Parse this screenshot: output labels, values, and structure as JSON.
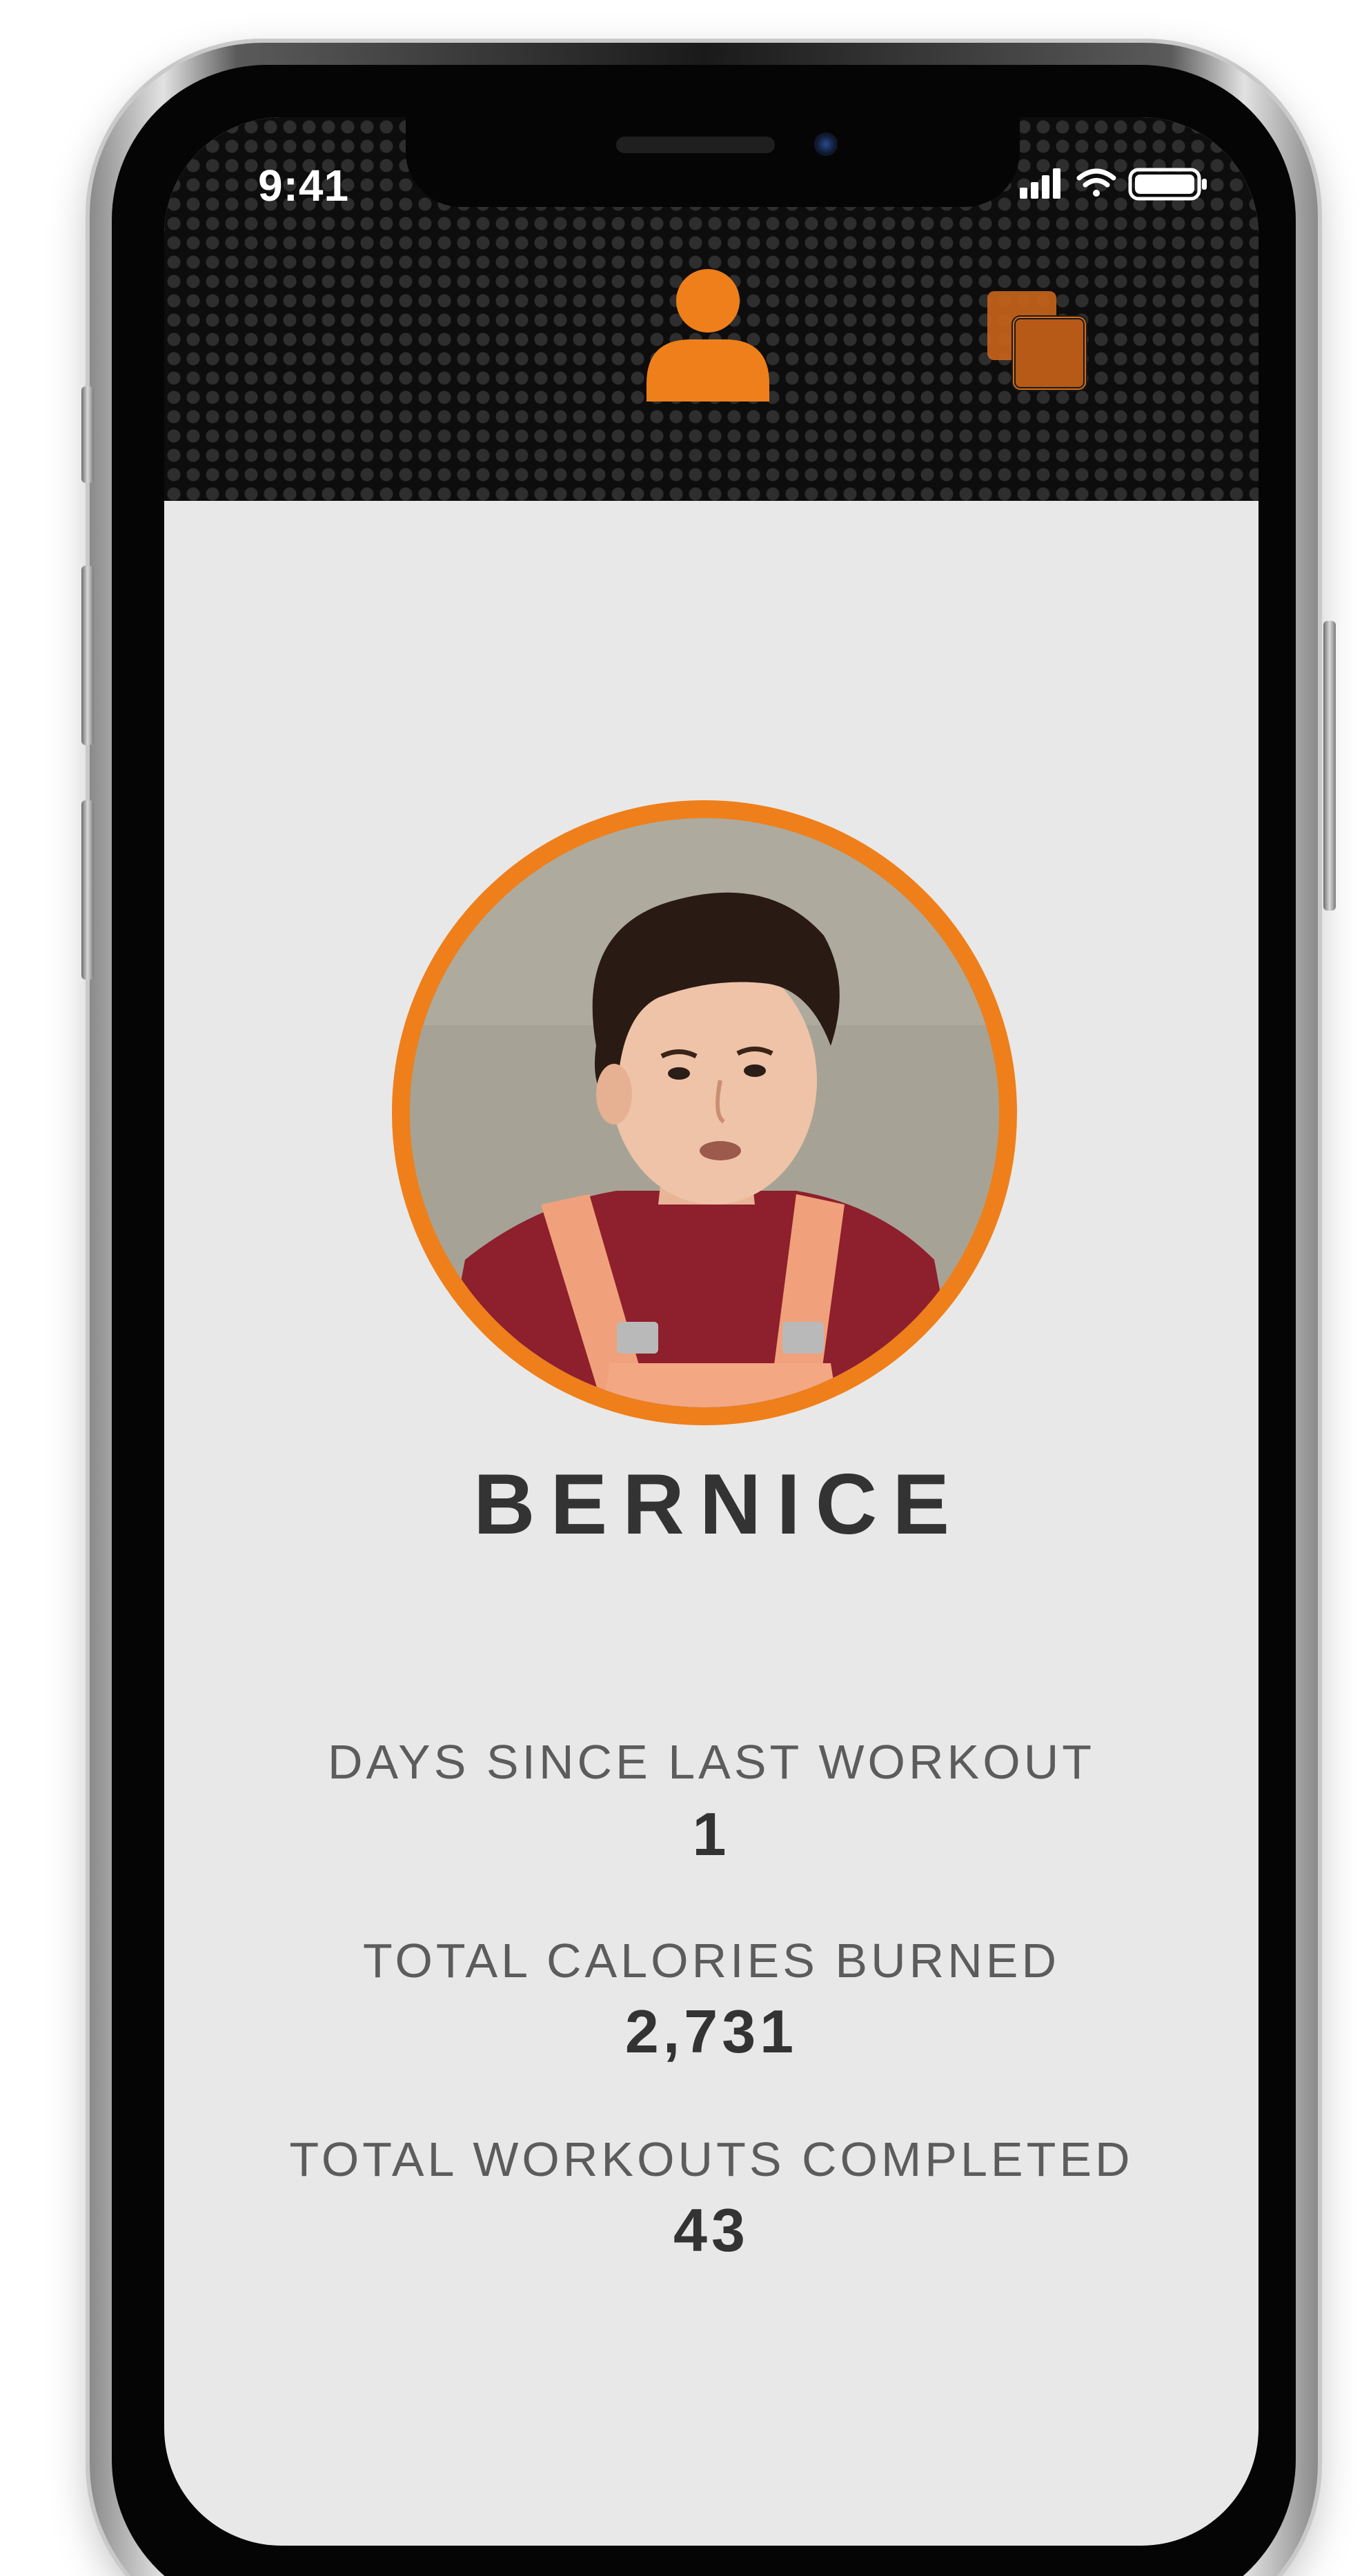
{
  "status_bar": {
    "time": "9:41"
  },
  "header": {
    "profile_icon": "person-icon",
    "cards_icon": "stacked-cards-icon",
    "accent_color": "#EF7F1A"
  },
  "profile": {
    "name": "BERNICE",
    "avatar_description_icon": "user-photo"
  },
  "stats": [
    {
      "label": "DAYS SINCE LAST WORKOUT",
      "value": "1"
    },
    {
      "label": "TOTAL CALORIES BURNED",
      "value": "2,731"
    },
    {
      "label": "TOTAL WORKOUTS COMPLETED",
      "value": "43"
    }
  ]
}
